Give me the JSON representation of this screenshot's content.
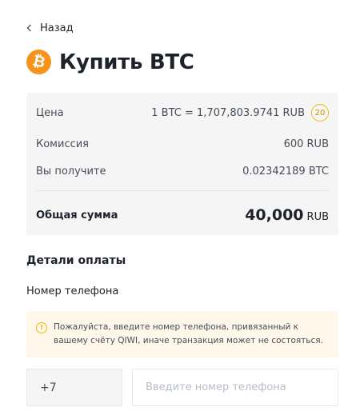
{
  "nav": {
    "back_label": "Назад"
  },
  "header": {
    "title": "Купить BTC",
    "coin_symbol": "₿",
    "coin_color": "#f7931a"
  },
  "summary": {
    "price_label": "Цена",
    "price_value": "1 BTC = 1,707,803.9741 RUB",
    "timer": "20",
    "fee_label": "Комиссия",
    "fee_value": "600 RUB",
    "receive_label": "Вы получите",
    "receive_value": "0.02342189 BTC",
    "total_label": "Общая сумма",
    "total_amount": "40,000",
    "total_currency": "RUB"
  },
  "payment": {
    "section_title": "Детали оплаты",
    "phone_label": "Номер телефона",
    "warning_text": "Пожалуйста, введите номер телефона, привязанный к вашему счёту QIWI, иначе транзакция может не состояться.",
    "country_code": "+7",
    "phone_placeholder": "Введите номер телефона",
    "phone_value": ""
  },
  "colors": {
    "accent": "#f0b90b",
    "warning_bg": "#fef7ea",
    "panel_bg": "#f5f5f5"
  }
}
